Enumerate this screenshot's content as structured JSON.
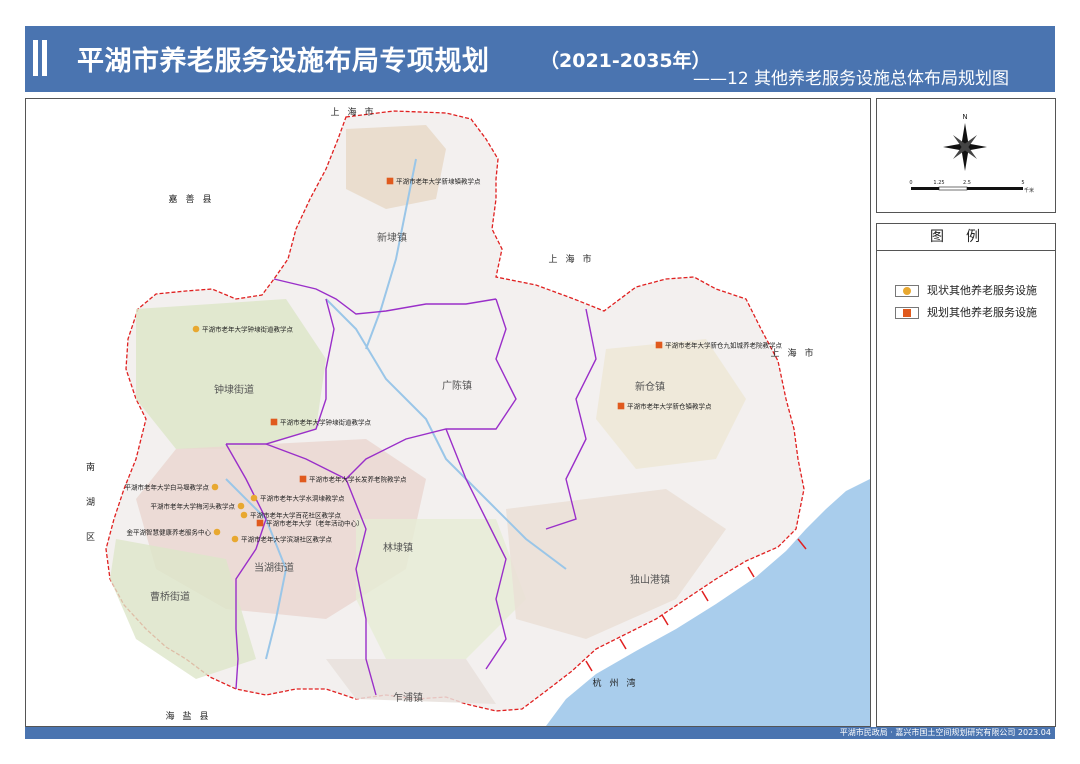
{
  "header": {
    "title": "平湖市养老服务设施布局专项规划",
    "years": "（2021-2035年）",
    "subtitle": "——12 其他养老服务设施总体布局规划图"
  },
  "compass": {
    "north": "N",
    "scale_ticks": [
      "0",
      "1.25",
      "2.5",
      "5"
    ],
    "scale_unit": "千米"
  },
  "legend": {
    "title": "图例",
    "items": [
      {
        "label": "现状其他养老服务设施",
        "color": "#e8a830"
      },
      {
        "label": "规划其他养老服务设施",
        "color": "#e05a1e"
      }
    ]
  },
  "regions": [
    {
      "label": "上海市"
    },
    {
      "label": "嘉善县"
    },
    {
      "label": "上海市"
    },
    {
      "label": "上海市"
    },
    {
      "label": "南湖区"
    },
    {
      "label": "海盐县"
    },
    {
      "label": "杭州湾"
    }
  ],
  "towns": [
    {
      "label": "新埭镇"
    },
    {
      "label": "广陈镇"
    },
    {
      "label": "新仓镇"
    },
    {
      "label": "钟埭街道"
    },
    {
      "label": "林埭镇"
    },
    {
      "label": "当湖街道"
    },
    {
      "label": "曹桥街道"
    },
    {
      "label": "独山港镇"
    },
    {
      "label": "乍浦镇"
    }
  ],
  "facilities": [
    {
      "label": "平湖市老年大学新埭镇教学点",
      "status": "planned"
    },
    {
      "label": "平湖市老年大学钟埭街道教学点",
      "status": "existing"
    },
    {
      "label": "平湖市老年大学新仓九如城养老院教学点",
      "status": "planned"
    },
    {
      "label": "平湖市老年大学新仓镇教学点",
      "status": "planned"
    },
    {
      "label": "平湖市老年大学钟埭街道教学点",
      "status": "planned"
    },
    {
      "label": "平湖市老年大学长发养老院教学点",
      "status": "planned"
    },
    {
      "label": "平湖市老年大学白马堰教学点",
      "status": "existing"
    },
    {
      "label": "平湖市老年大学水洞埭教学点",
      "status": "existing"
    },
    {
      "label": "平湖市老年大学梅河头教学点",
      "status": "existing"
    },
    {
      "label": "平湖市老年大学百花社区教学点",
      "status": "existing"
    },
    {
      "label": "平湖市老年大学（老年活动中心）",
      "status": "planned"
    },
    {
      "label": "金平湖智慧健康养老服务中心",
      "status": "existing"
    },
    {
      "label": "平湖市老年大学滨湖社区教学点",
      "status": "existing"
    }
  ],
  "footer": {
    "credit": "平湖市民政局 · 嘉兴市国土空间规划研究有限公司 2023.04"
  }
}
